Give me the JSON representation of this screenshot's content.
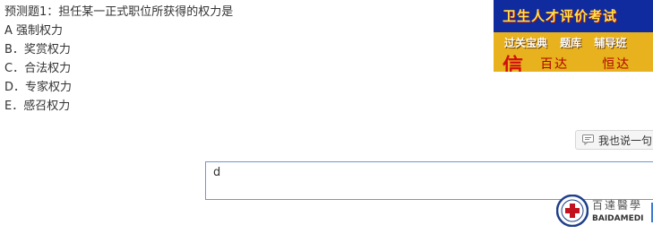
{
  "question": {
    "title": "预测题1：担任某一正式职位所获得的权力是",
    "options": [
      "A 强制权力",
      "B．奖赏权力",
      "C．合法权力",
      "D．专家权力",
      "E．感召权力"
    ]
  },
  "banner": {
    "title": "卫生人才评价考试",
    "links": "过关宝典 题库 辅导班",
    "xin": "信",
    "brand_left": "百达",
    "brand_right": "恒达",
    "colors": {
      "top": "#0f2b9e",
      "bottom": "#e7b21d",
      "title": "#ffe04a"
    }
  },
  "comment": {
    "label": "我也说一句",
    "icon": "comment-icon"
  },
  "answer": {
    "value": "d"
  },
  "logo": {
    "name_cn": "百達醫學",
    "name_en": "BAIDAMEDI"
  }
}
